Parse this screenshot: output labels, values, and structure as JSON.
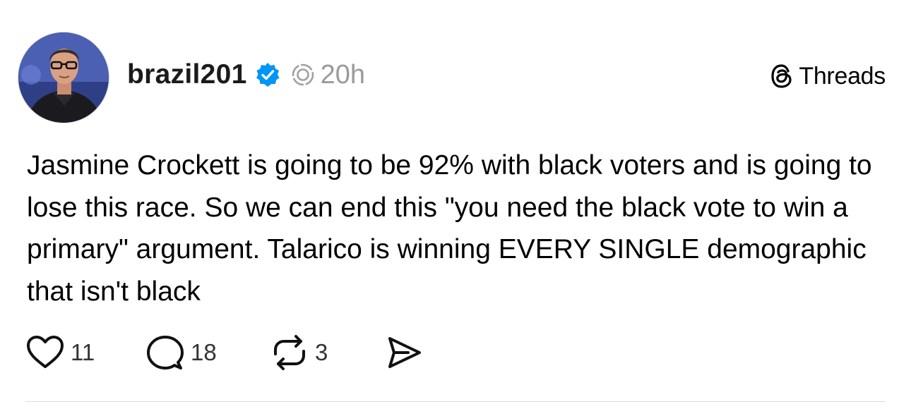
{
  "post": {
    "author": {
      "username": "brazil201",
      "verified": true,
      "avatar_icon": "profile-photo"
    },
    "timestamp": "20h",
    "brand": {
      "label": "Threads",
      "icon": "threads-logo-icon"
    },
    "text": "Jasmine Crockett is going to be 92% with black voters and is going to lose this race. So we can end this \"you need the black vote to win a primary\" argument. Talarico is winning EVERY SINGLE demographic that isn't black",
    "actions": {
      "likes": "11",
      "replies": "18",
      "reposts": "3"
    }
  },
  "colors": {
    "verified_badge": "#0095f6",
    "timestamp": "#9a9a9a",
    "text": "#000000"
  }
}
